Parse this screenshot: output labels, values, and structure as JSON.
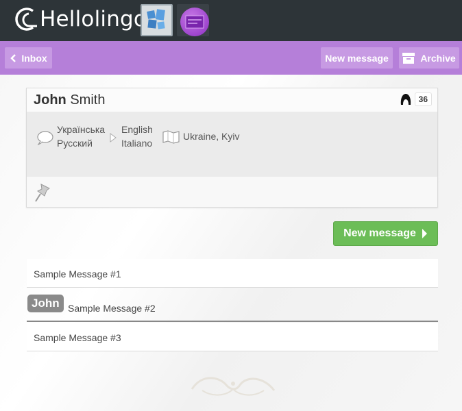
{
  "app": {
    "name": "Hellolingo"
  },
  "nav": {
    "inbox_label": "Inbox",
    "new_message_label": "New message",
    "archive_label": "Archive"
  },
  "profile": {
    "first_name": "John",
    "last_name": "Smith",
    "count": "36",
    "known_languages": [
      "Українська",
      "Русский"
    ],
    "learning_languages": [
      "English",
      "Italiano"
    ],
    "location": "Ukraine, Kyiv"
  },
  "actions": {
    "new_message_label": "New message"
  },
  "messages": [
    {
      "text": "Sample Message #1"
    },
    {
      "author": "John",
      "text": "Sample Message #2"
    },
    {
      "text": "Sample Message #3"
    }
  ],
  "colors": {
    "topbar": "#2d3438",
    "nav_purple": "#b57fd9",
    "green_button": "#6cbd57"
  }
}
